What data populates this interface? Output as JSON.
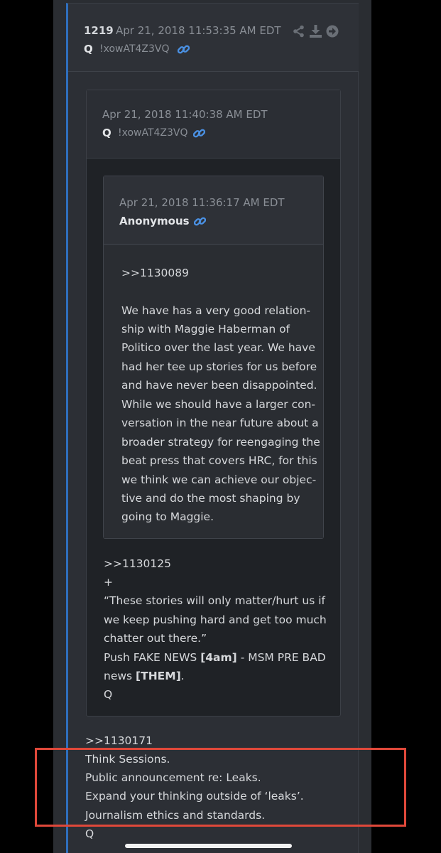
{
  "post": {
    "number": "1219",
    "date": "Apr 21, 2018 11:53:35 AM EDT",
    "author": "Q",
    "tripcode": "!xowAT4Z3VQ",
    "icons": [
      "share-icon",
      "download-icon",
      "arrow-right-icon",
      "link-icon"
    ],
    "body": {
      "ref": ">>1130171",
      "lines": [
        "Think Sessions.",
        "Public announcement re: Leaks.",
        "Expand your thinking outside of ‘leaks’.",
        "Journalism ethics and standards.",
        "Q"
      ]
    }
  },
  "quote1": {
    "date": "Apr 21, 2018 11:40:38 AM EDT",
    "author": "Q",
    "tripcode": "!xowAT4Z3VQ",
    "body": {
      "ref": ">>1130125",
      "plus": "+",
      "quote_lines": [
        "“These stories will only matter/hurt us if",
        "we keep pushing hard and get too much",
        "chatter out there.”"
      ],
      "push_prefix": "Push FAKE NEWS ",
      "push_bold1": "[4am]",
      "push_suffix": " - MSM PRE BAD",
      "news_prefix": "news ",
      "news_bold": "[THEM]",
      "news_suffix": ".",
      "signature": "Q"
    }
  },
  "quote2": {
    "date": "Apr 21, 2018 11:36:17 AM EDT",
    "author": "Anonymous",
    "body": {
      "ref": ">>1130089",
      "lines": [
        "We have has a very good relation-",
        "ship with Maggie Haberman of",
        "Politico over the last year. We have",
        "had her tee up stories for us before",
        "and have never been disappointed.",
        "While we should have a larger con-",
        "versation in the near future about a",
        "broader strategy for reengaging the",
        "beat press that covers HRC, for this",
        "we think we can achieve our objec-",
        "tive and do the most shaping by",
        "going to Maggie."
      ]
    }
  },
  "colors": {
    "accent": "#2f6fbd",
    "link": "#4a90e2",
    "highlight_box": "#e0483a"
  }
}
